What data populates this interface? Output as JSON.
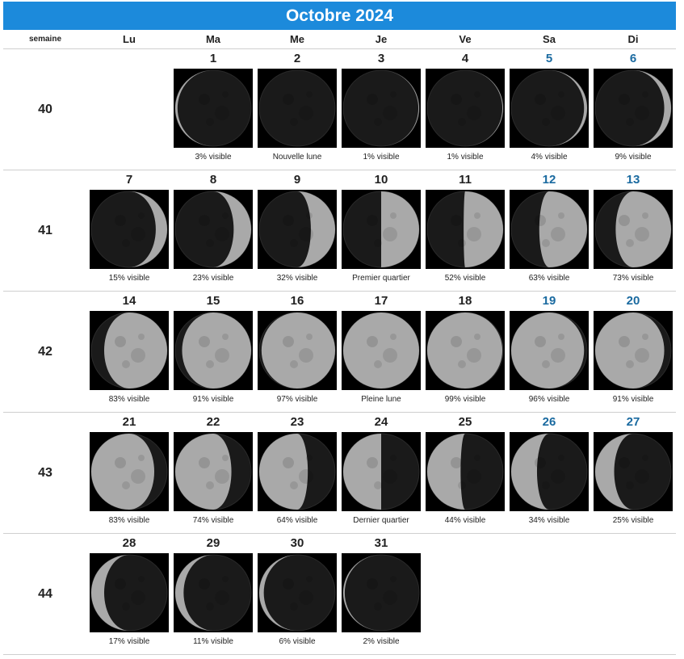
{
  "title": "Octobre 2024",
  "headers": {
    "week": "semaine",
    "days": [
      "Lu",
      "Ma",
      "Me",
      "Je",
      "Ve",
      "Sa",
      "Di"
    ]
  },
  "colors": {
    "title_bg": "#1c8adb",
    "weekend_number": "#1a6aa0",
    "moon_lit": "#a9a9a9",
    "moon_dark": "#1a1a1a"
  },
  "weeks": [
    {
      "number": "40",
      "days": [
        null,
        {
          "day": "1",
          "caption": "3% visible",
          "illum": 0.03,
          "waxing": false
        },
        {
          "day": "2",
          "caption": "Nouvelle lune",
          "illum": 0.0,
          "waxing": true
        },
        {
          "day": "3",
          "caption": "1% visible",
          "illum": 0.01,
          "waxing": true
        },
        {
          "day": "4",
          "caption": "1% visible",
          "illum": 0.01,
          "waxing": true
        },
        {
          "day": "5",
          "caption": "4% visible",
          "illum": 0.04,
          "waxing": true
        },
        {
          "day": "6",
          "caption": "9% visible",
          "illum": 0.09,
          "waxing": true
        }
      ]
    },
    {
      "number": "41",
      "days": [
        {
          "day": "7",
          "caption": "15% visible",
          "illum": 0.15,
          "waxing": true
        },
        {
          "day": "8",
          "caption": "23% visible",
          "illum": 0.23,
          "waxing": true
        },
        {
          "day": "9",
          "caption": "32% visible",
          "illum": 0.32,
          "waxing": true
        },
        {
          "day": "10",
          "caption": "Premier quartier",
          "illum": 0.5,
          "waxing": true
        },
        {
          "day": "11",
          "caption": "52% visible",
          "illum": 0.52,
          "waxing": true
        },
        {
          "day": "12",
          "caption": "63% visible",
          "illum": 0.63,
          "waxing": true
        },
        {
          "day": "13",
          "caption": "73% visible",
          "illum": 0.73,
          "waxing": true
        }
      ]
    },
    {
      "number": "42",
      "days": [
        {
          "day": "14",
          "caption": "83% visible",
          "illum": 0.83,
          "waxing": true
        },
        {
          "day": "15",
          "caption": "91% visible",
          "illum": 0.91,
          "waxing": true
        },
        {
          "day": "16",
          "caption": "97% visible",
          "illum": 0.97,
          "waxing": true
        },
        {
          "day": "17",
          "caption": "Pleine lune",
          "illum": 1.0,
          "waxing": true
        },
        {
          "day": "18",
          "caption": "99% visible",
          "illum": 0.99,
          "waxing": false
        },
        {
          "day": "19",
          "caption": "96% visible",
          "illum": 0.96,
          "waxing": false
        },
        {
          "day": "20",
          "caption": "91% visible",
          "illum": 0.91,
          "waxing": false
        }
      ]
    },
    {
      "number": "43",
      "days": [
        {
          "day": "21",
          "caption": "83% visible",
          "illum": 0.83,
          "waxing": false
        },
        {
          "day": "22",
          "caption": "74% visible",
          "illum": 0.74,
          "waxing": false
        },
        {
          "day": "23",
          "caption": "64% visible",
          "illum": 0.64,
          "waxing": false
        },
        {
          "day": "24",
          "caption": "Dernier quartier",
          "illum": 0.5,
          "waxing": false
        },
        {
          "day": "25",
          "caption": "44% visible",
          "illum": 0.44,
          "waxing": false
        },
        {
          "day": "26",
          "caption": "34% visible",
          "illum": 0.34,
          "waxing": false
        },
        {
          "day": "27",
          "caption": "25% visible",
          "illum": 0.25,
          "waxing": false
        }
      ]
    },
    {
      "number": "44",
      "days": [
        {
          "day": "28",
          "caption": "17% visible",
          "illum": 0.17,
          "waxing": false
        },
        {
          "day": "29",
          "caption": "11% visible",
          "illum": 0.11,
          "waxing": false
        },
        {
          "day": "30",
          "caption": "6% visible",
          "illum": 0.06,
          "waxing": false
        },
        {
          "day": "31",
          "caption": "2% visible",
          "illum": 0.02,
          "waxing": false
        },
        null,
        null,
        null
      ]
    }
  ]
}
